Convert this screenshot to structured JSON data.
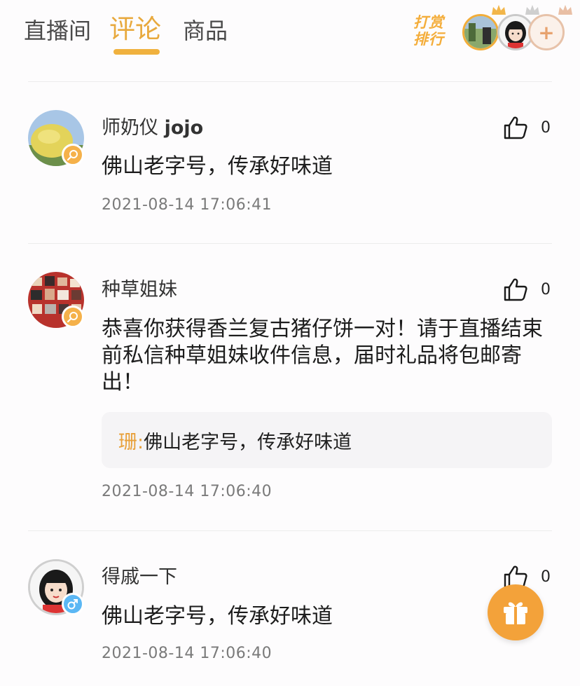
{
  "tabs": [
    {
      "label": "直播间",
      "active": false
    },
    {
      "label": "评论",
      "active": true
    },
    {
      "label": "商品",
      "active": false
    }
  ],
  "ranking": {
    "label": "打赏排行",
    "add_icon": "plus-icon",
    "gold_color": "#f2ad3a"
  },
  "comments": [
    {
      "user_name": "师奶仪",
      "user_tag": "jojo",
      "text": "佛山老字号，传承好味道",
      "time": "2021-08-14 17:06:41",
      "likes": "0",
      "badge_icon": "search-icon"
    },
    {
      "user_name": "种草姐妹",
      "text": "恭喜你获得香兰复古猪仔饼一对！请于直播结束前私信种草姐妹收件信息，届时礼品将包邮寄出！",
      "reply_name": "珊:",
      "reply_text": "佛山老字号，传承好味道",
      "time": "2021-08-14 17:06:40",
      "likes": "0",
      "badge_icon": "search-icon"
    },
    {
      "user_name": "得戚一下",
      "text": "佛山老字号，传承好味道",
      "time": "2021-08-14 17:06:40",
      "likes": "0",
      "badge_icon": "male-icon"
    }
  ],
  "gift_icon": "gift-icon",
  "colors": {
    "accent": "#f0b13e",
    "reply_name": "#e8a03a",
    "gift": "#f3a23a"
  }
}
